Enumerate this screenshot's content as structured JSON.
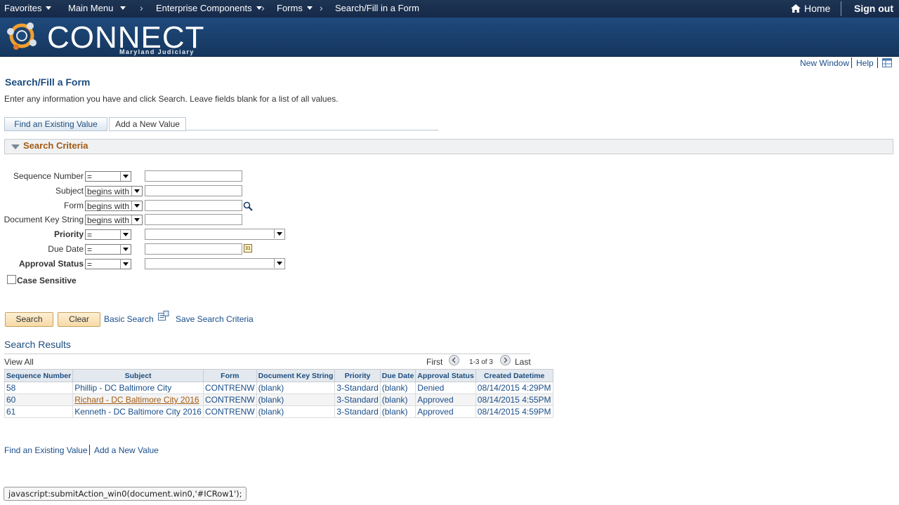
{
  "topnav": {
    "favorites": "Favorites",
    "main_menu": "Main Menu",
    "enterprise": "Enterprise Components",
    "forms": "Forms",
    "current": "Search/Fill in a Form",
    "home": "Home",
    "signout": "Sign out"
  },
  "banner": {
    "logo_text": "CONNECT",
    "logo_sub": "Maryland Judiciary"
  },
  "util": {
    "new_window": "New Window",
    "help": "Help"
  },
  "page": {
    "title": "Search/Fill a Form",
    "instructions": "Enter any information you have and click Search. Leave fields blank for a list of all values."
  },
  "tabs": {
    "find": "Find an Existing Value",
    "add": "Add a New Value"
  },
  "section": {
    "label": "Search Criteria"
  },
  "criteria": [
    {
      "label": "Sequence Number",
      "op": "="
    },
    {
      "label": "Subject",
      "op": "begins with"
    },
    {
      "label": "Form",
      "op": "begins with"
    },
    {
      "label": "Document Key String",
      "op": "begins with"
    },
    {
      "label": "Priority",
      "op": "="
    },
    {
      "label": "Due Date",
      "op": "="
    },
    {
      "label": "Approval Status",
      "op": "="
    }
  ],
  "case_sensitive": "Case Sensitive",
  "buttons": {
    "search": "Search",
    "clear": "Clear",
    "basic_search": "Basic Search",
    "save_criteria": "Save Search Criteria"
  },
  "results": {
    "title": "Search Results",
    "view_all": "View All",
    "first": "First",
    "count": "1-3 of 3",
    "last": "Last",
    "columns": [
      "Sequence Number",
      "Subject",
      "Form",
      "Document Key String",
      "Priority",
      "Due Date",
      "Approval Status",
      "Created Datetime"
    ],
    "rows": [
      [
        "58",
        "Phillip - DC Baltimore City",
        "CONTRENW",
        "(blank)",
        "3-Standard",
        "(blank)",
        "Denied",
        "08/14/2015  4:29PM"
      ],
      [
        "60",
        "Richard - DC Baltimore City 2016",
        "CONTRENW",
        "(blank)",
        "3-Standard",
        "(blank)",
        "Approved",
        "08/14/2015  4:55PM"
      ],
      [
        "61",
        "Kenneth - DC Baltimore City 2016",
        "CONTRENW",
        "(blank)",
        "3-Standard",
        "(blank)",
        "Approved",
        "08/14/2015  4:59PM"
      ]
    ]
  },
  "footer": {
    "find": "Find an Existing Value",
    "add": "Add a New Value"
  },
  "statusbar": "javascript:submitAction_win0(document.win0,'#ICRow1');"
}
